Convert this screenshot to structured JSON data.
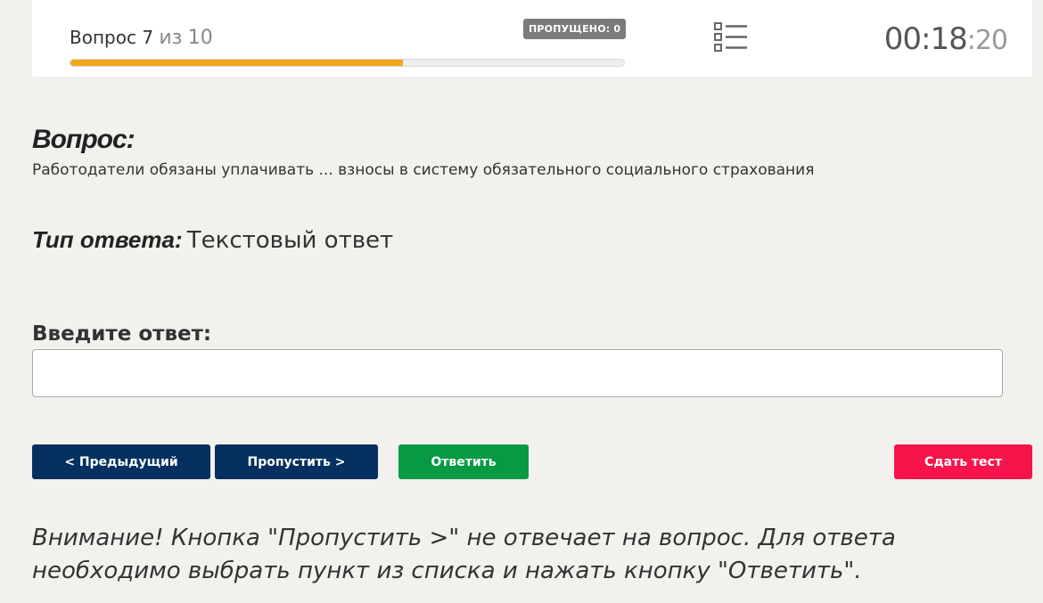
{
  "header": {
    "question_word": "Вопрос",
    "current": "7",
    "of_word": "из",
    "total": "10",
    "progress_fraction": 0.6,
    "skipped_badge": "ПРОПУЩЕНО: 0",
    "list_icon": "list-icon",
    "timer_main": "00:18",
    "timer_sep": ":",
    "timer_seconds": "20"
  },
  "question": {
    "title": "Вопрос:",
    "text": "Работодатели обязаны уплачивать ... взносы в систему обязательного социального страхования"
  },
  "answer_type": {
    "label": "Тип ответа:",
    "value": "Текстовый ответ"
  },
  "answer": {
    "label": "Введите ответ:",
    "value": "",
    "placeholder": ""
  },
  "buttons": {
    "prev": "< Предыдущий",
    "skip": "Пропустить >",
    "answer": "Ответить",
    "submit": "Сдать тест"
  },
  "colors": {
    "progress": "#f2a71b",
    "navy": "#05305f",
    "green": "#069a45",
    "red": "#f7144a",
    "background": "#f2f1ee"
  },
  "warning": {
    "line1": "Внимание! Кнопка \"Пропустить >\" не отвечает на вопрос. Для ответа",
    "line2": "необходимо выбрать пункт из списка и нажать кнопку \"Ответить\"."
  }
}
